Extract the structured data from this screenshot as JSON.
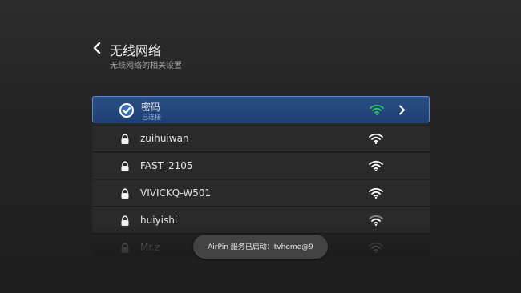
{
  "header": {
    "back_icon": "chevron-left-icon",
    "title": "无线网络",
    "subtitle": "无线网络的相关设置"
  },
  "networks": [
    {
      "name": "密码",
      "status": "已连接",
      "icon": "check-circle-icon",
      "signal_icon": "wifi-icon",
      "selected": true
    },
    {
      "name": "zuihuiwan",
      "icon": "lock-icon",
      "signal_icon": "wifi-icon"
    },
    {
      "name": "FAST_2105",
      "icon": "lock-icon",
      "signal_icon": "wifi-icon"
    },
    {
      "name": "VIVICKQ-W501",
      "icon": "lock-icon",
      "signal_icon": "wifi-icon"
    },
    {
      "name": "huiyishi",
      "icon": "lock-icon",
      "signal_icon": "wifi-icon"
    },
    {
      "name": "Mr.z",
      "icon": "lock-icon",
      "signal_icon": "wifi-icon"
    }
  ],
  "toast": {
    "text": "AirPin 服务已启动：tvhome@9"
  },
  "colors": {
    "selected_bg": "#244a80",
    "selected_border": "#5a8ad0",
    "connected_signal": "#2fc45a",
    "signal": "#ffffff"
  }
}
